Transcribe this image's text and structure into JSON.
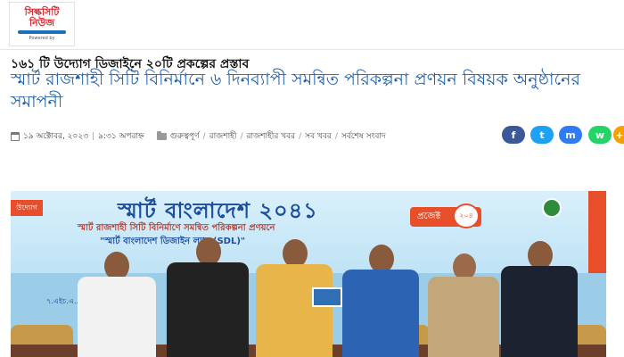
{
  "site": {
    "logo_line1": "সিল্কসিটি",
    "logo_line2": "নিউজ",
    "logo_powered": "Powered by"
  },
  "article": {
    "kicker": "১৬১ টি উদ্যোগ ডিজাইনে ২০টি প্রকল্পের প্রস্তাব",
    "headline": "স্মার্ট রাজশাহী সিটি বিনির্মানে ৬ দিনব্যাপী সমন্বিত পরিকল্পনা প্রণয়ন বিষয়ক অনুষ্ঠানের সমাপনী",
    "date": "১৯ অক্টোবর, ২০২৩",
    "time": "৯:৩১ অপরাহ্ন",
    "categories": [
      "গুরুত্বপূর্ণ",
      "রাজশাহী",
      "রাজশাহীর খবর",
      "সব খবর",
      "সর্বশেষ সংবাদ"
    ]
  },
  "share": {
    "facebook": "f",
    "twitter": "t",
    "messenger": "m",
    "whatsapp": "w",
    "more": "+"
  },
  "photo": {
    "banner_left": "উদ্যোগ",
    "banner_title": "স্মার্ট বাংলাদেশ ২০৪১",
    "banner_sub1": "স্মার্ট রাজশাহী সিটি বিনির্মাণে সমন্বিত পরিকল্পনা প্রণয়নে",
    "banner_sub2": "\"স্মার্ট বাংলাদেশ ডিজাইন ল্যাব (SDL)\"",
    "banner_project": "প্রজেক্ট",
    "banner_badge": "২০৪",
    "footer_text": "৭.এইচ.এ..."
  },
  "colors": {
    "headline": "#1f5fa8",
    "banner_title": "#1d4e9e",
    "accent": "#e94e2a"
  }
}
